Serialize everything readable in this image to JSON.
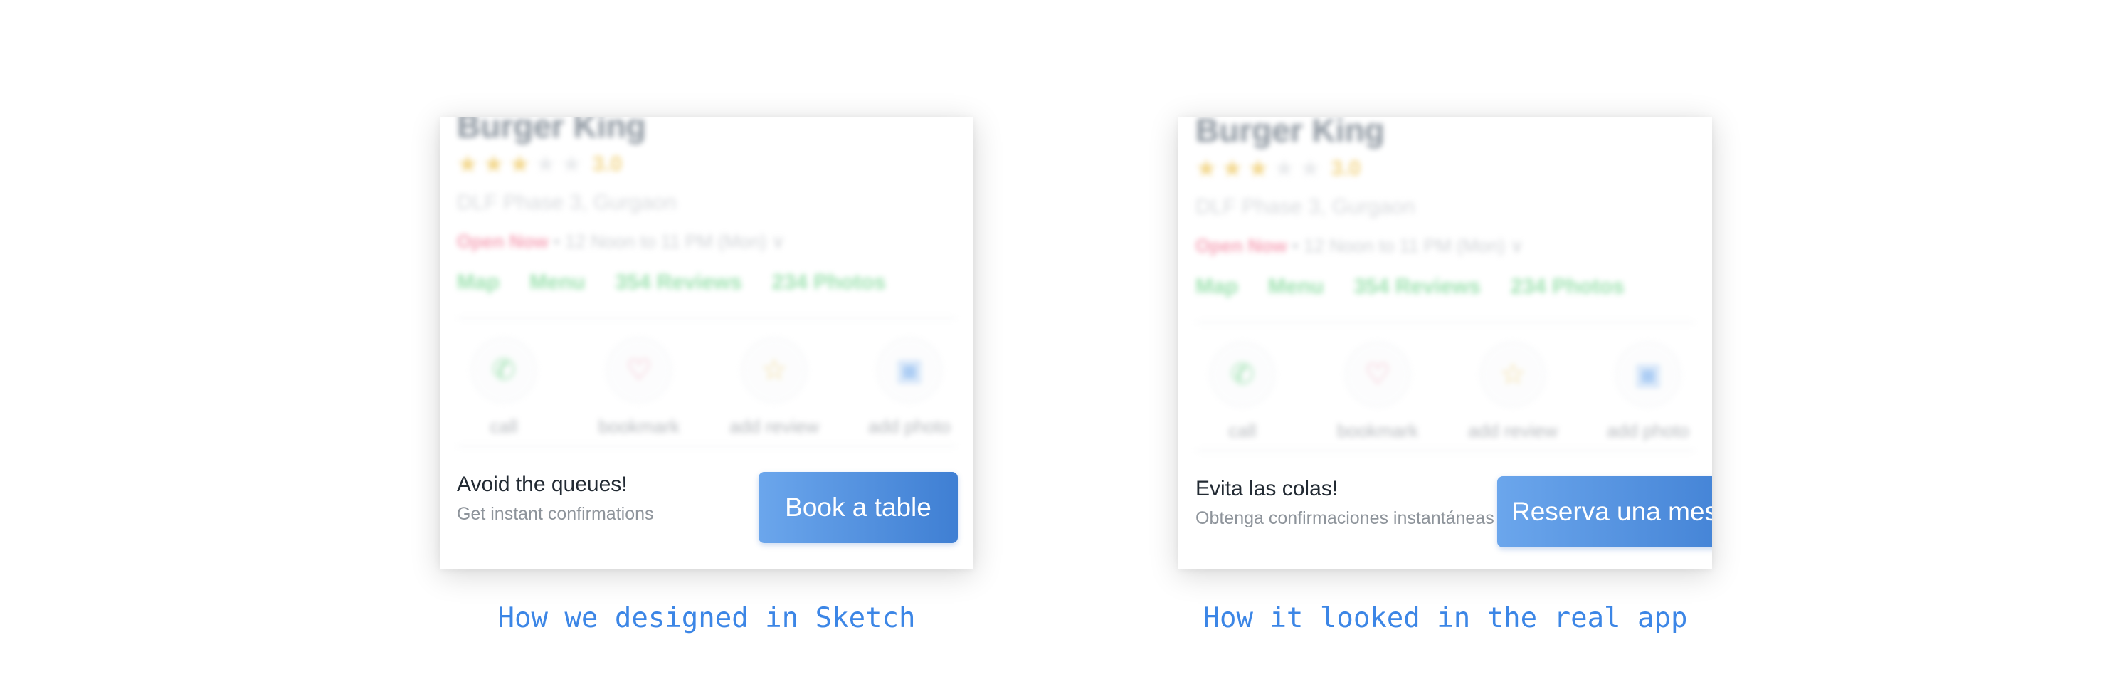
{
  "sketch": {
    "restaurant_name": "Burger King",
    "rating": "3.0",
    "stars_filled": 3,
    "stars_total": 5,
    "address": "DLF Phase 3, Gurgaon",
    "open_status": "Open Now",
    "hours": " • 12 Noon to 11 PM (Mon) ∨",
    "links": [
      "Map",
      "Menu",
      "354 Reviews",
      "234 Photos"
    ],
    "actions": [
      {
        "icon": "phone-icon",
        "label": "call"
      },
      {
        "icon": "heart-icon",
        "label": "bookmark"
      },
      {
        "icon": "star-icon",
        "label": "add review"
      },
      {
        "icon": "photo-icon",
        "label": "add photo"
      }
    ],
    "cta_title": "Avoid the queues!",
    "cta_subtitle": "Get instant confirmations",
    "cta_button": "Book a table"
  },
  "real_app": {
    "restaurant_name": "Burger King",
    "rating": "3.0",
    "stars_filled": 3,
    "stars_total": 5,
    "address": "DLF Phase 3, Gurgaon",
    "open_status": "Open Now",
    "hours": " • 12 Noon to 11 PM (Mon) ∨",
    "links": [
      "Map",
      "Menu",
      "354 Reviews",
      "234 Photos"
    ],
    "actions": [
      {
        "icon": "phone-icon",
        "label": "call"
      },
      {
        "icon": "heart-icon",
        "label": "bookmark"
      },
      {
        "icon": "star-icon",
        "label": "add review"
      },
      {
        "icon": "photo-icon",
        "label": "add photo"
      }
    ],
    "cta_title": "Evita las colas!",
    "cta_subtitle": "Obtenga confirmaciones instantáneas",
    "cta_button": "Reserva una mesa"
  },
  "captions": {
    "left": "How we designed in Sketch",
    "right": "How it looked in the real app"
  },
  "colors": {
    "accent": "#3c86e6",
    "button_start": "#6ba6ec",
    "button_end": "#3f7fd3",
    "open_now": "#ef5a7e",
    "link_green": "#4cca6e",
    "star": "#e8b52b"
  }
}
